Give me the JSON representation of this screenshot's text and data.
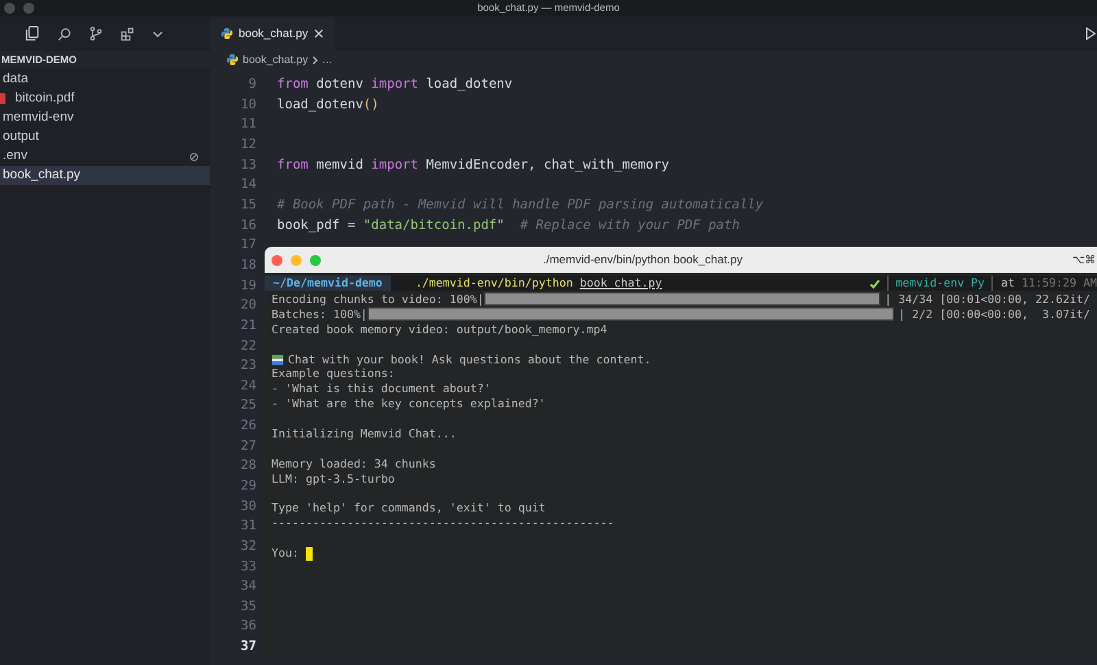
{
  "window": {
    "title": "book_chat.py — memvid-demo"
  },
  "sidebar": {
    "title": "MEMVID-DEMO",
    "items": [
      {
        "label": "data",
        "kind": "folder",
        "selected": false,
        "children": [
          {
            "label": "bitcoin.pdf",
            "kind": "pdf",
            "selected": false
          }
        ]
      },
      {
        "label": "memvid-env",
        "kind": "folder",
        "selected": false
      },
      {
        "label": "output",
        "kind": "folder",
        "selected": false
      },
      {
        "label": ".env",
        "kind": "ignored",
        "selected": false
      },
      {
        "label": "book_chat.py",
        "kind": "file",
        "selected": true
      }
    ]
  },
  "tabs": [
    {
      "label": "book_chat.py",
      "selected": true
    }
  ],
  "breadcrumb": [
    "book_chat.py",
    "…"
  ],
  "editor": {
    "lines": [
      {
        "number": "9",
        "current": false,
        "tokens": [
          {
            "kind": "keyword",
            "text": "from"
          },
          {
            "kind": "plain",
            "text": " dotenv "
          },
          {
            "kind": "keyword",
            "text": "import"
          },
          {
            "kind": "plain",
            "text": " load_dotenv"
          }
        ]
      },
      {
        "number": "10",
        "current": false,
        "tokens": [
          {
            "kind": "plain",
            "text": "load_dotenv"
          },
          {
            "kind": "paren",
            "text": "()"
          }
        ]
      },
      {
        "number": "11",
        "current": false
      },
      {
        "number": "12",
        "current": false
      },
      {
        "number": "13",
        "current": false,
        "tokens": [
          {
            "kind": "keyword",
            "text": "from"
          },
          {
            "kind": "plain",
            "text": " memvid "
          },
          {
            "kind": "keyword",
            "text": "import"
          },
          {
            "kind": "plain",
            "text": " MemvidEncoder, chat_with_memory"
          }
        ]
      },
      {
        "number": "14",
        "current": false
      },
      {
        "number": "15",
        "current": false,
        "tokens": [
          {
            "kind": "comment",
            "text": "# Book PDF path - Memvid will handle PDF parsing automatically"
          }
        ]
      },
      {
        "number": "16",
        "current": false,
        "tokens": [
          {
            "kind": "plain",
            "text": "book_pdf = "
          },
          {
            "kind": "string",
            "text": "\"data/bitcoin.pdf\""
          },
          {
            "kind": "comment",
            "text": "  # Replace with your PDF path"
          }
        ]
      },
      {
        "number": "17",
        "current": false
      },
      {
        "number": "18",
        "current": false
      },
      {
        "number": "19",
        "current": false
      },
      {
        "number": "20",
        "current": false
      },
      {
        "number": "21",
        "current": false
      },
      {
        "number": "22",
        "current": false
      },
      {
        "number": "23",
        "current": false
      },
      {
        "number": "24",
        "current": false
      },
      {
        "number": "25",
        "current": false
      },
      {
        "number": "26",
        "current": false
      },
      {
        "number": "27",
        "current": false
      },
      {
        "number": "28",
        "current": false
      },
      {
        "number": "29",
        "current": false
      },
      {
        "number": "30",
        "current": false
      },
      {
        "number": "31",
        "current": false
      },
      {
        "number": "32",
        "current": false
      },
      {
        "number": "33",
        "current": false
      },
      {
        "number": "34",
        "current": false
      },
      {
        "number": "35",
        "current": false
      },
      {
        "number": "36",
        "current": false
      },
      {
        "number": "37",
        "current": true
      }
    ]
  },
  "terminal": {
    "title": "./memvid-env/bin/python book_chat.py",
    "shortcut": "⌥⌘",
    "prompt": {
      "path": "~/De/memvid-demo",
      "command": "./memvid-env/bin/python",
      "argument": "book_chat.py",
      "env": "memvid-env Py",
      "time_prefix": "at",
      "time": "11:59:29 AM"
    },
    "lines": [
      {
        "kind": "progress",
        "label": "Encoding chunks to video: 100%|",
        "level": 1,
        "stats": "| 34/34 [00:01<00:00, 22.62it/"
      },
      {
        "kind": "progress",
        "label": "Batches: 100%|",
        "level": 1,
        "stats": "| 2/2 [00:00<00:00,  3.07it/"
      },
      {
        "kind": "text",
        "text": "Created book memory video: output/book_memory.mp4"
      },
      {
        "kind": "blank"
      },
      {
        "kind": "books",
        "text": "Chat with your book! Ask questions about the content."
      },
      {
        "kind": "text",
        "text": "Example questions:"
      },
      {
        "kind": "text",
        "text": "- 'What is this document about?'"
      },
      {
        "kind": "text",
        "text": "- 'What are the key concepts explained?'"
      },
      {
        "kind": "blank"
      },
      {
        "kind": "text",
        "text": "Initializing Memvid Chat..."
      },
      {
        "kind": "blank"
      },
      {
        "kind": "text",
        "text": "Memory loaded: 34 chunks"
      },
      {
        "kind": "text",
        "text": "LLM: gpt-3.5-turbo"
      },
      {
        "kind": "blank"
      },
      {
        "kind": "text",
        "text": "Type 'help' for commands, 'exit' to quit"
      },
      {
        "kind": "text",
        "text": "--------------------------------------------------"
      },
      {
        "kind": "blank"
      },
      {
        "kind": "input",
        "text": "You:"
      }
    ]
  }
}
